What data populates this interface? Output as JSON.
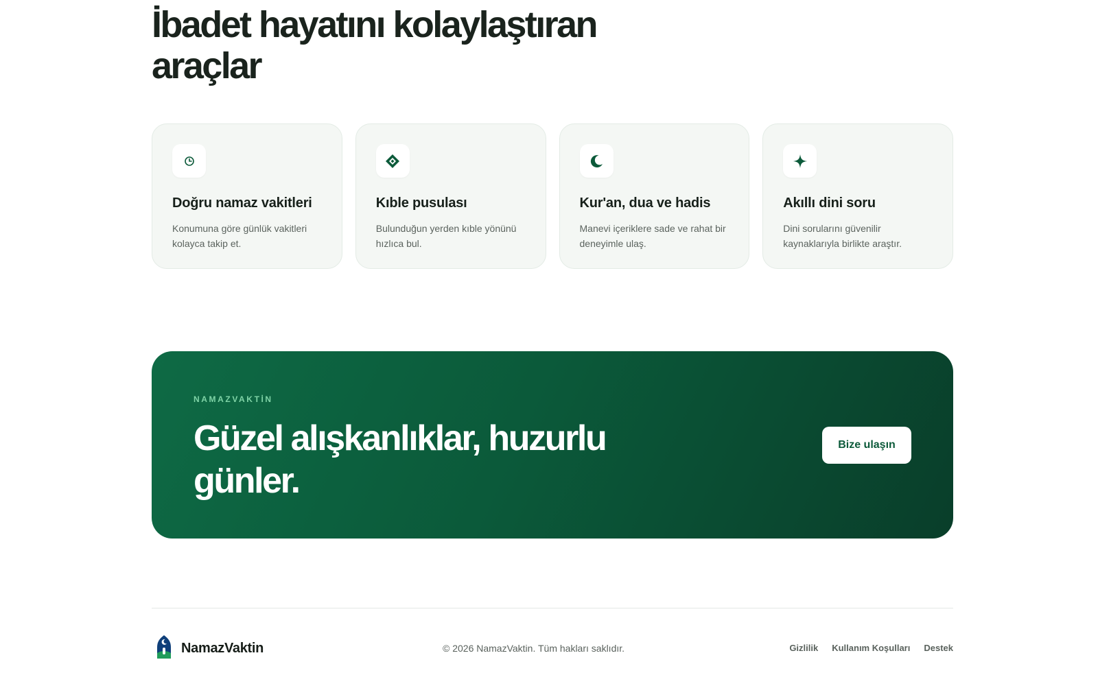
{
  "hero": {
    "title_line1": "İbadet hayatını kolaylaştıran",
    "title_line2": "araçlar"
  },
  "features": [
    {
      "icon": "clock-icon",
      "title": "Doğru namaz vakitleri",
      "description": "Konumuna göre günlük vakitleri kolayca takip et."
    },
    {
      "icon": "compass-diamond-icon",
      "title": "Kıble pusulası",
      "description": "Bulunduğun yerden kıble yönünü hızlıca bul."
    },
    {
      "icon": "crescent-moon-icon",
      "title": "Kur'an, dua ve hadis",
      "description": "Manevi içeriklere sade ve rahat bir deneyimle ulaş."
    },
    {
      "icon": "sparkle-icon",
      "title": "Akıllı dini soru",
      "description": "Dini sorularını güvenilir kaynaklarıyla birlikte araştır."
    }
  ],
  "cta": {
    "eyebrow": "NAMAZVAKTİN",
    "title_line1": "Güzel alışkanlıklar, huzurlu",
    "title_line2": "günler.",
    "button_label": "Bize ulaşın"
  },
  "footer": {
    "brand_name": "NamazVaktin",
    "logo_icon": "mosque-logo-icon",
    "copyright": "© 2026 NamazVaktin. Tüm hakları saklıdır.",
    "links": [
      "Gizlilik",
      "Kullanım Koşulları",
      "Destek"
    ]
  },
  "colors": {
    "primary_green": "#0c5a3a",
    "card_background": "#f4f7f4",
    "eyebrow_green": "#7fd3a6",
    "heading_text": "#1a231d"
  }
}
